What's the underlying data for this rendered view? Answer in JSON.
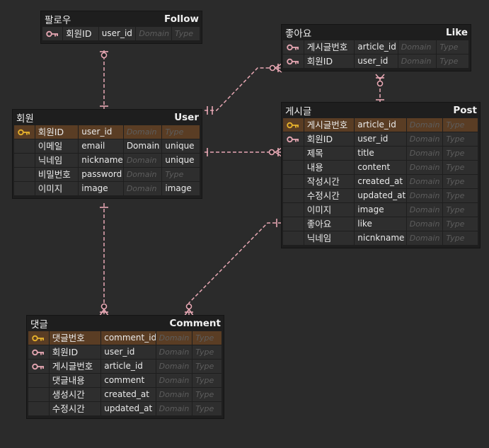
{
  "colors": {
    "background": "#2b2b2b",
    "table": "#1e1e1e",
    "pk_row": "#5a3d24",
    "relation": "#e8a8b4",
    "pk_key": "#e9b42c",
    "fk_key": "#e8a8b4"
  },
  "tables": {
    "follow": {
      "ko": "팔로우",
      "en": "Follow",
      "columns": [
        {
          "key": "fk-key-icon",
          "logical": "회원ID",
          "physical": "user_id",
          "domain": "Domain",
          "type": "Type",
          "domain_ghost": true,
          "type_ghost": true
        }
      ]
    },
    "like": {
      "ko": "좋아요",
      "en": "Like",
      "columns": [
        {
          "key": "fk-key-icon",
          "logical": "게시글번호",
          "physical": "article_id",
          "domain": "Domain",
          "type": "Type",
          "domain_ghost": true,
          "type_ghost": true
        },
        {
          "key": "fk-key-icon",
          "logical": "회원ID",
          "physical": "user_id",
          "domain": "Domain",
          "type": "Type",
          "domain_ghost": true,
          "type_ghost": true
        }
      ]
    },
    "user": {
      "ko": "회원",
      "en": "User",
      "columns": [
        {
          "key": "pk-key-icon",
          "pk": true,
          "logical": "회원ID",
          "physical": "user_id",
          "domain": "Domain",
          "type": "Type",
          "domain_ghost": true,
          "type_ghost": true
        },
        {
          "key": "",
          "logical": "이메일",
          "physical": "email",
          "domain": "Domain",
          "type": "unique",
          "domain_ghost": false,
          "type_ghost": false
        },
        {
          "key": "",
          "logical": "닉네임",
          "physical": "nickname",
          "domain": "Domain",
          "type": "unique",
          "domain_ghost": true,
          "type_ghost": false
        },
        {
          "key": "",
          "logical": "비밀번호",
          "physical": "password",
          "domain": "Domain",
          "type": "Type",
          "domain_ghost": true,
          "type_ghost": true
        },
        {
          "key": "",
          "logical": "이미지",
          "physical": "image",
          "domain": "Domain",
          "type": "image",
          "domain_ghost": true,
          "type_ghost": false
        }
      ]
    },
    "post": {
      "ko": "게시글",
      "en": "Post",
      "columns": [
        {
          "key": "pk-key-icon",
          "pk": true,
          "logical": "게시글번호",
          "physical": "article_id",
          "domain": "Domain",
          "type": "Type",
          "domain_ghost": true,
          "type_ghost": true
        },
        {
          "key": "fk-key-icon",
          "logical": "회원ID",
          "physical": "user_id",
          "domain": "Domain",
          "type": "Type",
          "domain_ghost": true,
          "type_ghost": true
        },
        {
          "key": "",
          "logical": "제목",
          "physical": "title",
          "domain": "Domain",
          "type": "Type",
          "domain_ghost": true,
          "type_ghost": true
        },
        {
          "key": "",
          "logical": "내용",
          "physical": "content",
          "domain": "Domain",
          "type": "Type",
          "domain_ghost": true,
          "type_ghost": true
        },
        {
          "key": "",
          "logical": "작성시간",
          "physical": "created_at",
          "domain": "Domain",
          "type": "Type",
          "domain_ghost": true,
          "type_ghost": true
        },
        {
          "key": "",
          "logical": "수정시간",
          "physical": "updated_at",
          "domain": "Domain",
          "type": "Type",
          "domain_ghost": true,
          "type_ghost": true
        },
        {
          "key": "",
          "logical": "이미지",
          "physical": "image",
          "domain": "Domain",
          "type": "Type",
          "domain_ghost": true,
          "type_ghost": true
        },
        {
          "key": "",
          "logical": "좋아요",
          "physical": "like",
          "domain": "Domain",
          "type": "Type",
          "domain_ghost": true,
          "type_ghost": true
        },
        {
          "key": "",
          "logical": "닉네임",
          "physical": "nicnkname",
          "domain": "Domain",
          "type": "Type",
          "domain_ghost": true,
          "type_ghost": true
        }
      ]
    },
    "comment": {
      "ko": "댓글",
      "en": "Comment",
      "columns": [
        {
          "key": "pk-key-icon",
          "pk": true,
          "logical": "댓글번호",
          "physical": "comment_id",
          "domain": "Domain",
          "type": "Type",
          "domain_ghost": true,
          "type_ghost": true
        },
        {
          "key": "fk-key-icon",
          "logical": "회원ID",
          "physical": "user_id",
          "domain": "Domain",
          "type": "Type",
          "domain_ghost": true,
          "type_ghost": true
        },
        {
          "key": "fk-key-icon",
          "logical": "게시글번호",
          "physical": "article_id",
          "domain": "Domain",
          "type": "Type",
          "domain_ghost": true,
          "type_ghost": true
        },
        {
          "key": "",
          "logical": "댓글내용",
          "physical": "comment",
          "domain": "Domain",
          "type": "Type",
          "domain_ghost": true,
          "type_ghost": true
        },
        {
          "key": "",
          "logical": "생성시간",
          "physical": "created_at",
          "domain": "Domain",
          "type": "Type",
          "domain_ghost": true,
          "type_ghost": true
        },
        {
          "key": "",
          "logical": "수정시간",
          "physical": "updated_at",
          "domain": "Domain",
          "type": "Type",
          "domain_ghost": true,
          "type_ghost": true
        }
      ]
    }
  },
  "relationships": [
    {
      "from": "user",
      "to": "follow",
      "kind": "one-to-zero-or-many"
    },
    {
      "from": "user",
      "to": "like",
      "kind": "one-to-zero-or-many"
    },
    {
      "from": "post",
      "to": "like",
      "kind": "one-to-zero-or-many"
    },
    {
      "from": "user",
      "to": "post",
      "kind": "one-to-zero-or-many"
    },
    {
      "from": "user",
      "to": "comment",
      "kind": "one-to-zero-or-many"
    },
    {
      "from": "post",
      "to": "comment",
      "kind": "one-to-zero-or-many"
    }
  ]
}
